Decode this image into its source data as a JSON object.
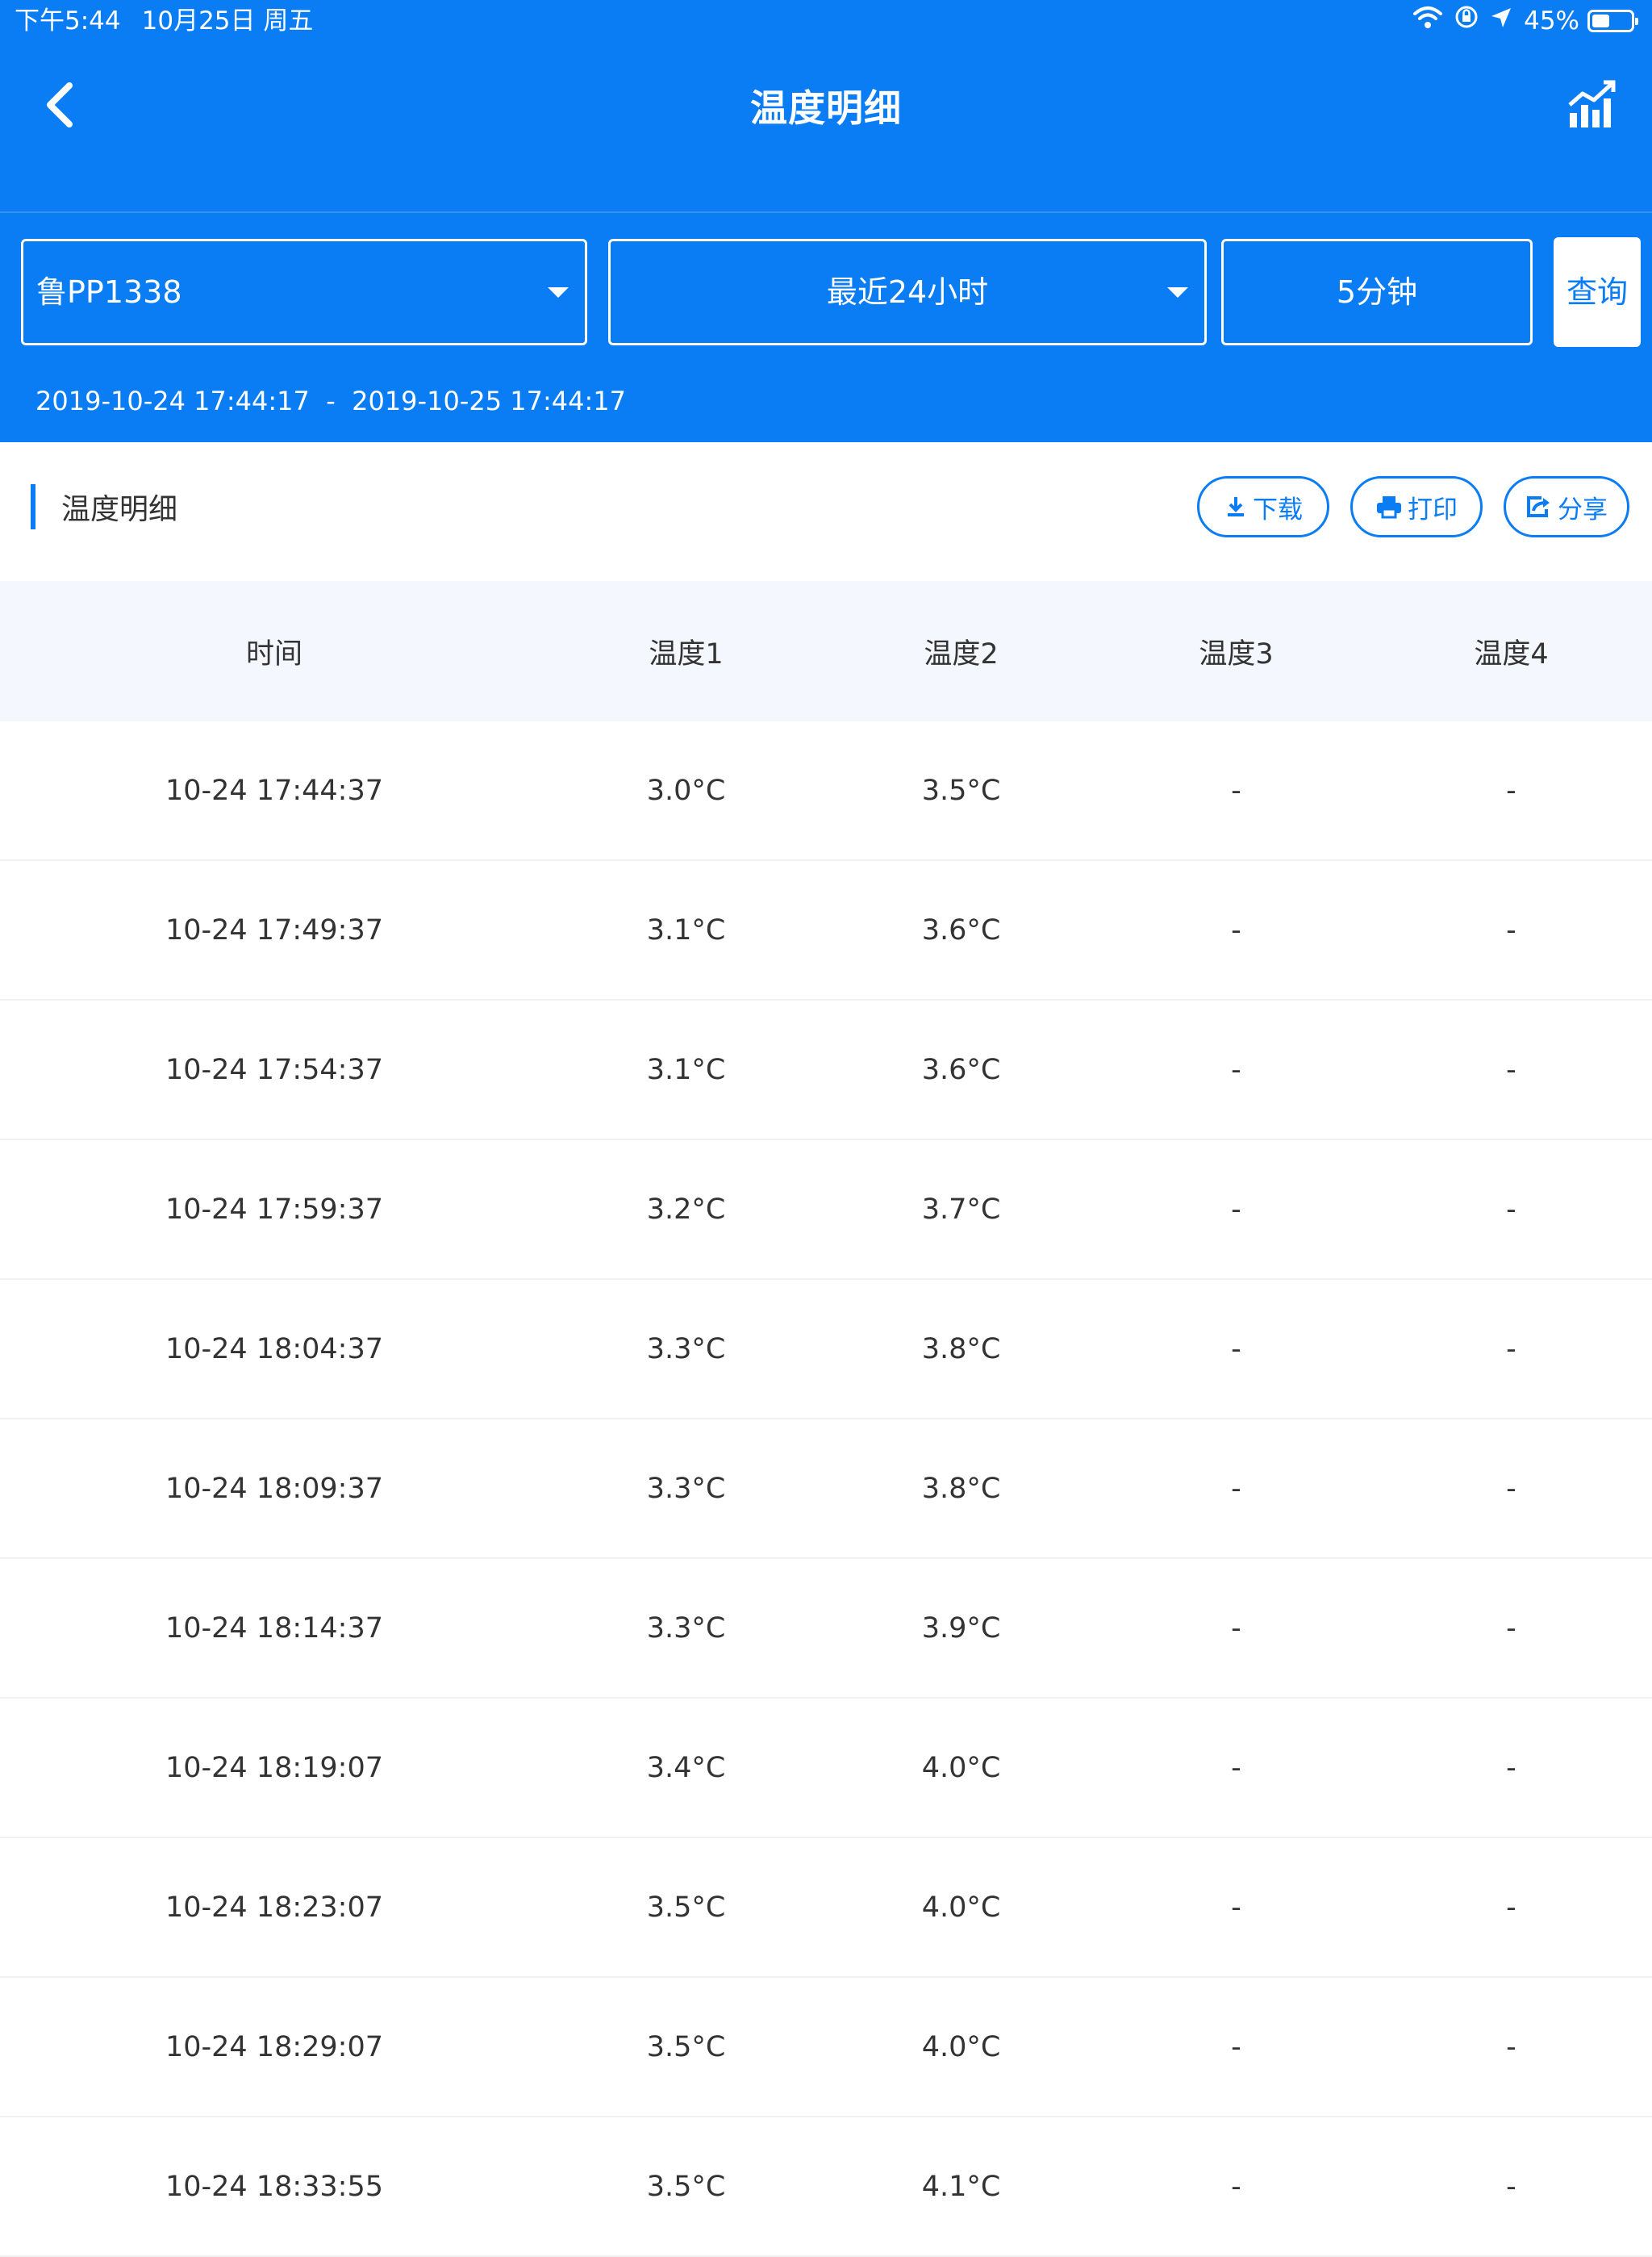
{
  "status_bar": {
    "time": "下午5:44",
    "date": "10月25日 周五",
    "battery": "45%",
    "battery_fraction": 0.45,
    "icons": [
      "wifi-icon",
      "orientation-lock-icon",
      "location-arrow-icon",
      "battery-icon"
    ]
  },
  "nav": {
    "title": "温度明细",
    "back_icon": "chevron-left-icon",
    "chart_icon": "trend-chart-icon"
  },
  "filters": {
    "vehicle": "鲁PP1338",
    "range": "最近24小时",
    "interval": "5分钟",
    "query_label": "查询"
  },
  "date_range": {
    "start": "2019-10-24 17:44:17",
    "separator": "-",
    "end": "2019-10-25 17:44:17"
  },
  "section": {
    "title": "温度明细",
    "download_label": "下载",
    "print_label": "打印",
    "share_label": "分享"
  },
  "colors": {
    "primary": "#0a7cf4",
    "header_row_bg": "#f4f8fe",
    "text": "#333333"
  },
  "table": {
    "columns": [
      "时间",
      "温度1",
      "温度2",
      "温度3",
      "温度4"
    ],
    "rows": [
      [
        "10-24 17:44:37",
        "3.0°C",
        "3.5°C",
        "-",
        "-"
      ],
      [
        "10-24 17:49:37",
        "3.1°C",
        "3.6°C",
        "-",
        "-"
      ],
      [
        "10-24 17:54:37",
        "3.1°C",
        "3.6°C",
        "-",
        "-"
      ],
      [
        "10-24 17:59:37",
        "3.2°C",
        "3.7°C",
        "-",
        "-"
      ],
      [
        "10-24 18:04:37",
        "3.3°C",
        "3.8°C",
        "-",
        "-"
      ],
      [
        "10-24 18:09:37",
        "3.3°C",
        "3.8°C",
        "-",
        "-"
      ],
      [
        "10-24 18:14:37",
        "3.3°C",
        "3.9°C",
        "-",
        "-"
      ],
      [
        "10-24 18:19:07",
        "3.4°C",
        "4.0°C",
        "-",
        "-"
      ],
      [
        "10-24 18:23:07",
        "3.5°C",
        "4.0°C",
        "-",
        "-"
      ],
      [
        "10-24 18:29:07",
        "3.5°C",
        "4.0°C",
        "-",
        "-"
      ],
      [
        "10-24 18:33:55",
        "3.5°C",
        "4.1°C",
        "-",
        "-"
      ]
    ]
  }
}
